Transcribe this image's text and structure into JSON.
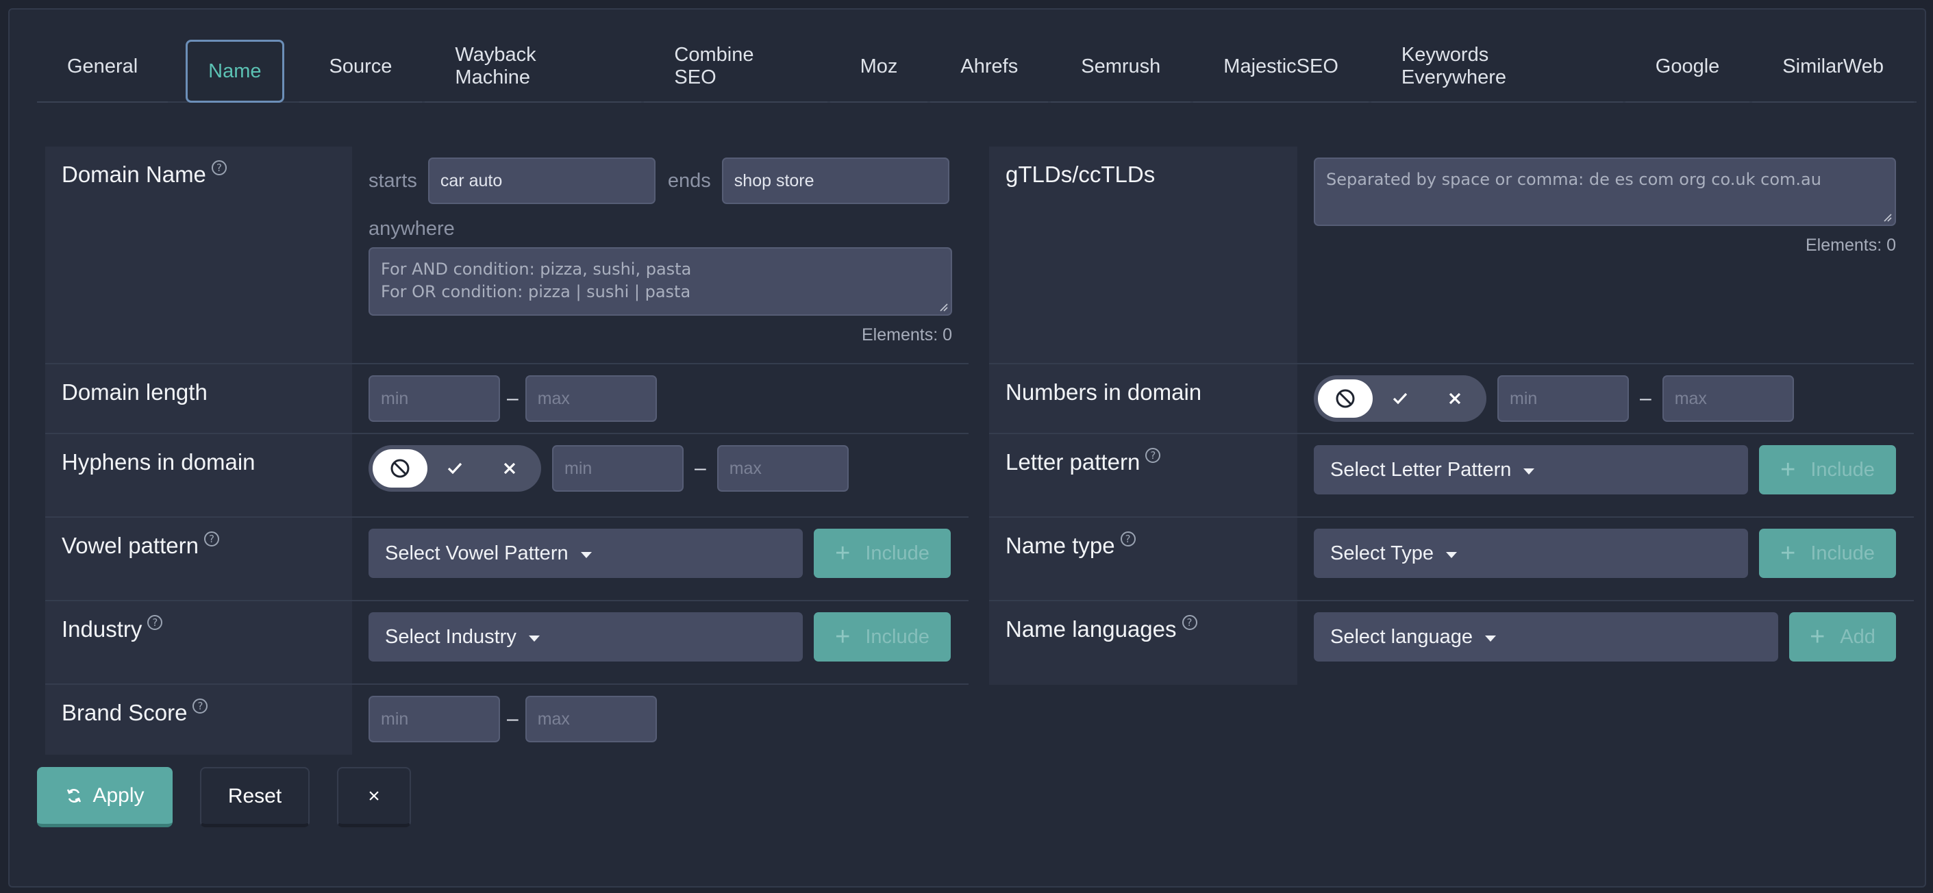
{
  "tabs": [
    "General",
    "Name",
    "Source",
    "Wayback Machine",
    "Combine SEO",
    "Moz",
    "Ahrefs",
    "Semrush",
    "MajesticSEO",
    "Keywords Everywhere",
    "Google",
    "SimilarWeb"
  ],
  "active_tab": "Name",
  "domain_name": {
    "label": "Domain Name",
    "starts_label": "starts",
    "starts_value": "car auto",
    "ends_label": "ends",
    "ends_value": "shop store",
    "anywhere_label": "anywhere",
    "anywhere_placeholder_1": "For AND condition: pizza, sushi, pasta",
    "anywhere_placeholder_2": "For OR condition: pizza | sushi | pasta",
    "elements": "Elements: 0"
  },
  "tlds": {
    "label": "gTLDs/ccTLDs",
    "placeholder": "Separated by space or comma: de es com org co.uk com.au",
    "elements": "Elements: 0"
  },
  "domain_length": {
    "label": "Domain length",
    "min": "min",
    "max": "max"
  },
  "numbers_in_domain": {
    "label": "Numbers in domain",
    "min": "min",
    "max": "max"
  },
  "hyphens_in_domain": {
    "label": "Hyphens in domain",
    "min": "min",
    "max": "max"
  },
  "letter_pattern": {
    "label": "Letter pattern",
    "select": "Select Letter Pattern",
    "button": "Include"
  },
  "vowel_pattern": {
    "label": "Vowel pattern",
    "select": "Select Vowel Pattern",
    "button": "Include"
  },
  "name_type": {
    "label": "Name type",
    "select": "Select Type",
    "button": "Include"
  },
  "industry": {
    "label": "Industry",
    "select": "Select Industry",
    "button": "Include"
  },
  "name_languages": {
    "label": "Name languages",
    "select": "Select language",
    "button": "Add"
  },
  "brand_score": {
    "label": "Brand Score",
    "min": "min",
    "max": "max"
  },
  "actions": {
    "apply": "Apply",
    "reset": "Reset",
    "close": "×"
  },
  "colors": {
    "accent": "#5cc2b4",
    "apply_bg": "#5aa9a3",
    "panel_label_bg": "#2b3141",
    "page_bg": "#242a38"
  }
}
